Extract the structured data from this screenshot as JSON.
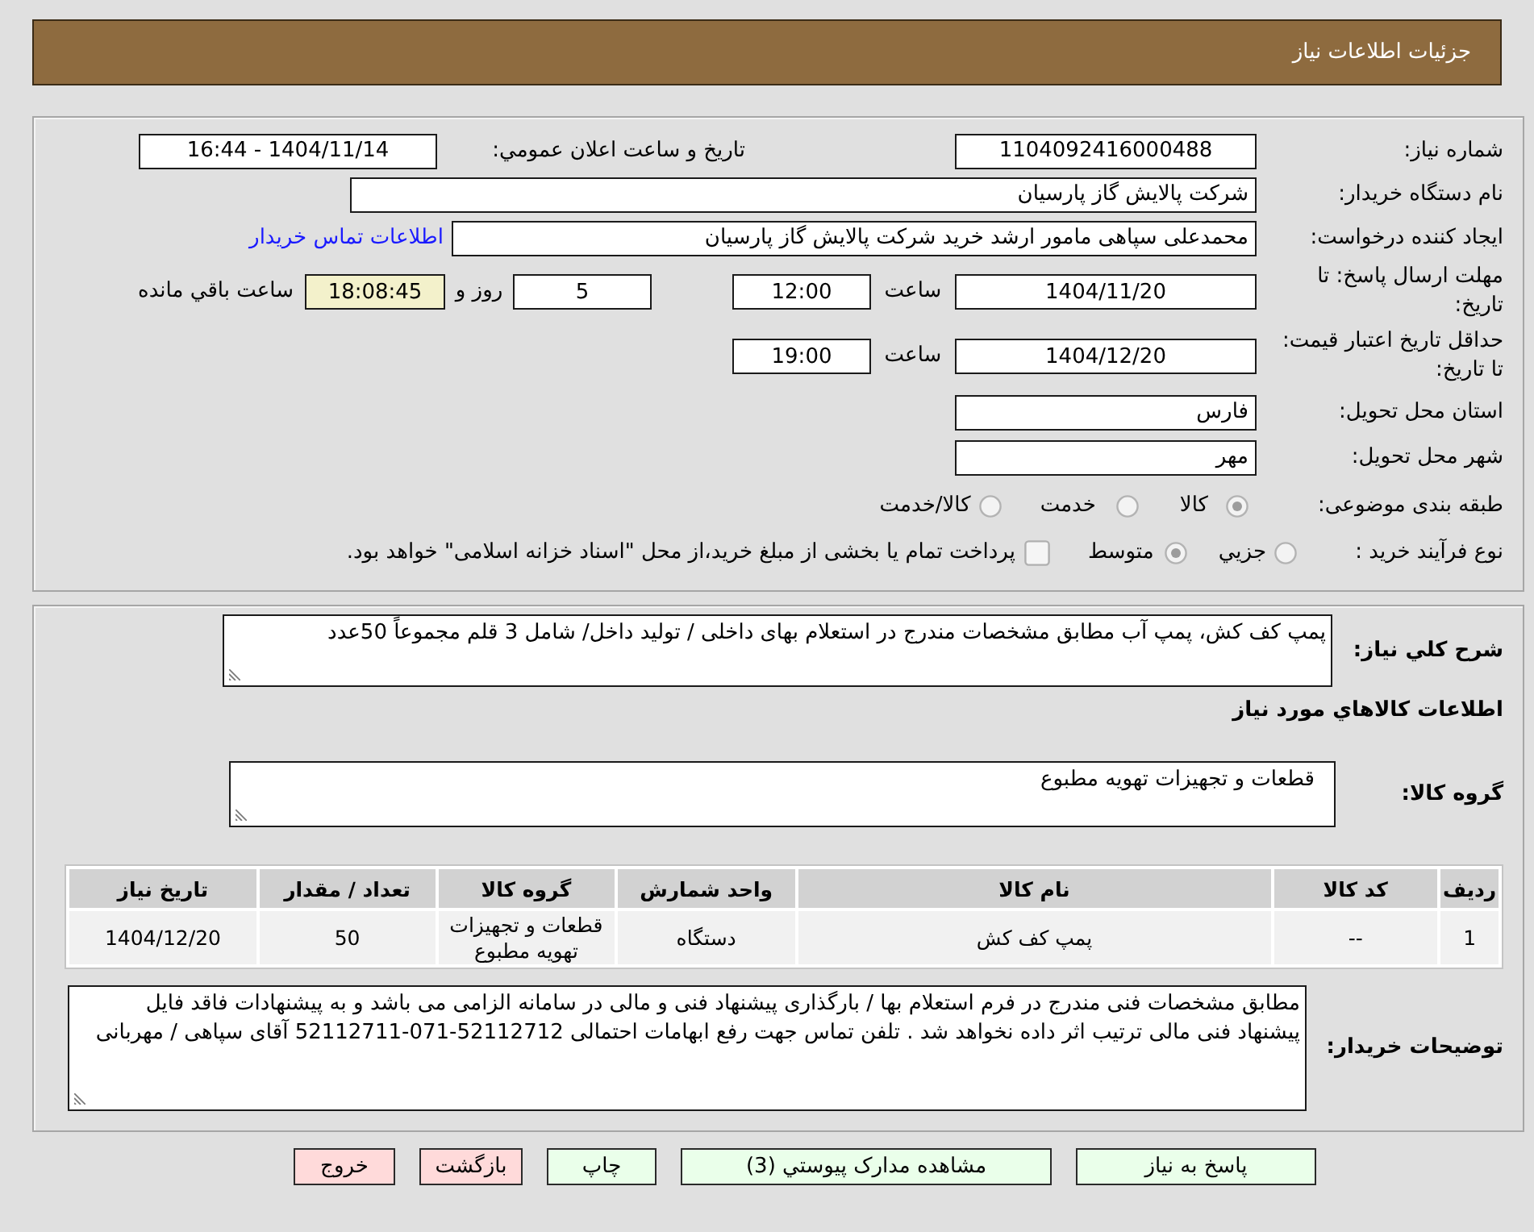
{
  "header": {
    "title": "جزئیات اطلاعات نیاز"
  },
  "summary": {
    "need_number_label": "شماره نیاز:",
    "need_number": "1104092416000488",
    "announce_label": "تاریخ و ساعت اعلان عمومي:",
    "announce_datetime": "1404/11/14 - 16:44",
    "buyer_org_label": "نام دستگاه خریدار:",
    "buyer_org": "شرکت پالایش گاز پارسیان",
    "requester_label": "ایجاد کننده درخواست:",
    "requester": "محمدعلی سپاهی مامور ارشد خرید شرکت پالایش گاز پارسیان",
    "contact_link": "اطلاعات تماس خریدار"
  },
  "deadline": {
    "label": "مهلت ارسال پاسخ: تا تاریخ:",
    "date": "1404/11/20",
    "time_label": "ساعت",
    "time": "12:00",
    "days": "5",
    "days_label": "روز و",
    "remaining": "18:08:45",
    "remaining_label": "ساعت باقي مانده"
  },
  "validity": {
    "label": "حداقل تاریخ اعتبار قیمت: تا تاریخ:",
    "date": "1404/12/20",
    "time_label": "ساعت",
    "time": "19:00"
  },
  "delivery": {
    "province_label": "استان محل تحویل:",
    "province": "فارس",
    "city_label": "شهر محل تحویل:",
    "city": "مهر"
  },
  "category": {
    "label": "طبقه بندی موضوعی:",
    "options": [
      {
        "label": "کالا",
        "selected": true
      },
      {
        "label": "خدمت",
        "selected": false
      },
      {
        "label": "کالا/خدمت",
        "selected": false
      }
    ]
  },
  "purchase_process": {
    "label": "نوع فرآیند خرید :",
    "options": [
      {
        "label": "جزيي",
        "selected": false
      },
      {
        "label": "متوسط",
        "selected": true
      }
    ],
    "treasury": {
      "label": "پرداخت تمام یا بخشی از مبلغ خرید،از محل \"اسناد خزانه اسلامی\" خواهد بود.",
      "checked": false
    }
  },
  "general_description": {
    "label": "شرح کلي نیاز:",
    "value": "پمپ کف کش، پمپ آب مطابق مشخصات مندرج در استعلام بهای داخلی / تولید داخل/ شامل 3 قلم مجموعاً 50عدد"
  },
  "goods_section_title": "اطلاعات کالاهاي مورد نیاز",
  "goods_group": {
    "label": "گروه کالا:",
    "value": "قطعات و تجهیزات تهویه مطبوع"
  },
  "goods_table": {
    "columns": [
      "ردیف",
      "کد کالا",
      "نام کالا",
      "واحد شمارش",
      "گروه کالا",
      "تعداد / مقدار",
      "تاریخ نیاز"
    ],
    "rows": [
      [
        "1",
        "--",
        "پمپ کف کش",
        "دستگاه",
        "قطعات و تجهیزات تهویه مطبوع",
        "50",
        "1404/12/20"
      ]
    ]
  },
  "buyer_notes": {
    "label": "توضیحات خریدار:",
    "value": "مطابق مشخصات فنی مندرج در فرم استعلام بها / بارگذاری پیشنهاد فنی و مالی در سامانه الزامی می باشد و به پیشنهادات فاقد فایل پیشنهاد فنی مالی ترتیب اثر داده نخواهد شد . تلفن تماس جهت رفع ابهامات احتمالی 52112712-071-52112711 آقای سپاهی / مهربانی"
  },
  "buttons": [
    {
      "label": "پاسخ به نیاز",
      "kind": "action"
    },
    {
      "label": "مشاهده مدارک پیوستي (3)",
      "kind": "action"
    },
    {
      "label": "چاپ",
      "kind": "action"
    },
    {
      "label": "بازگشت",
      "kind": "exit"
    },
    {
      "label": "خروج",
      "kind": "exit"
    }
  ]
}
